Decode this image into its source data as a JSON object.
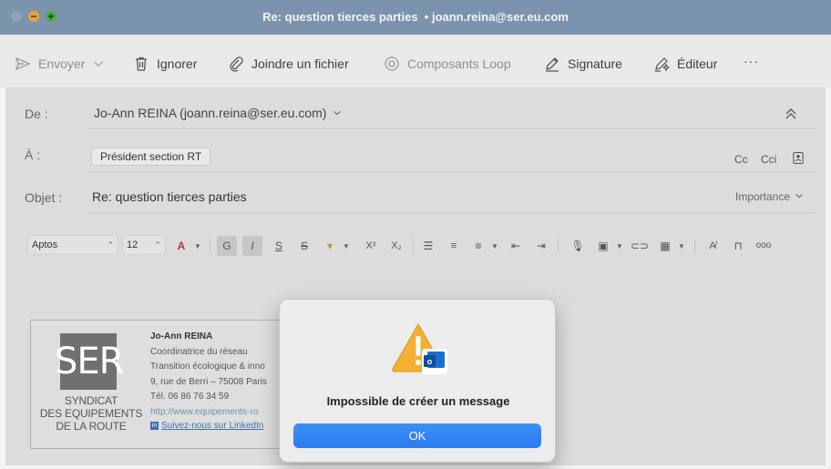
{
  "window": {
    "title": "Re: question tierces parties",
    "title_account": "• joann.reina@ser.eu.com"
  },
  "toolbar": {
    "send": "Envoyer",
    "ignore": "Ignorer",
    "attach": "Joindre un fichier",
    "loop": "Composants Loop",
    "signature": "Signature",
    "editor": "Éditeur",
    "more": "···"
  },
  "header": {
    "from_label": "De :",
    "from_value": "Jo-Ann REINA (joann.reina@ser.eu.com)",
    "to_label": "À :",
    "to_chip": "Président section RT",
    "cc": "Cc",
    "bcc": "Cci",
    "subject_label": "Objet :",
    "subject_value": "Re: question tierces parties",
    "importance": "Importance"
  },
  "format": {
    "font": "Aptos",
    "size": "12",
    "bold": "G",
    "italic": "I",
    "underline": "S",
    "strike": "S",
    "superscript": "X²",
    "subscript": "X₂",
    "more": "ooo"
  },
  "signature": {
    "logo_mark": "SER",
    "logo_line1": "SYNDICAT",
    "logo_line2": "DES EQUIPEMENTS",
    "logo_line3": "DE LA ROUTE",
    "name": "Jo-Ann REINA",
    "role": "Coordinatrice du réseau",
    "dept": "Transition écologique & inno",
    "address": "9, rue de Berri – 75008 Paris",
    "phone": "Tél. 06 86 76 34 59",
    "website": "http://www.equipements-ro",
    "linkedin": "Suivez-nous sur LinkedIn",
    "linkedin_badge": "in"
  },
  "dialog": {
    "message": "Impossible de créer un message",
    "ok": "OK"
  },
  "colors": {
    "titlebar": "#7c93ad",
    "ok_button": "#2a7cf0",
    "warning": "#f2b134"
  }
}
